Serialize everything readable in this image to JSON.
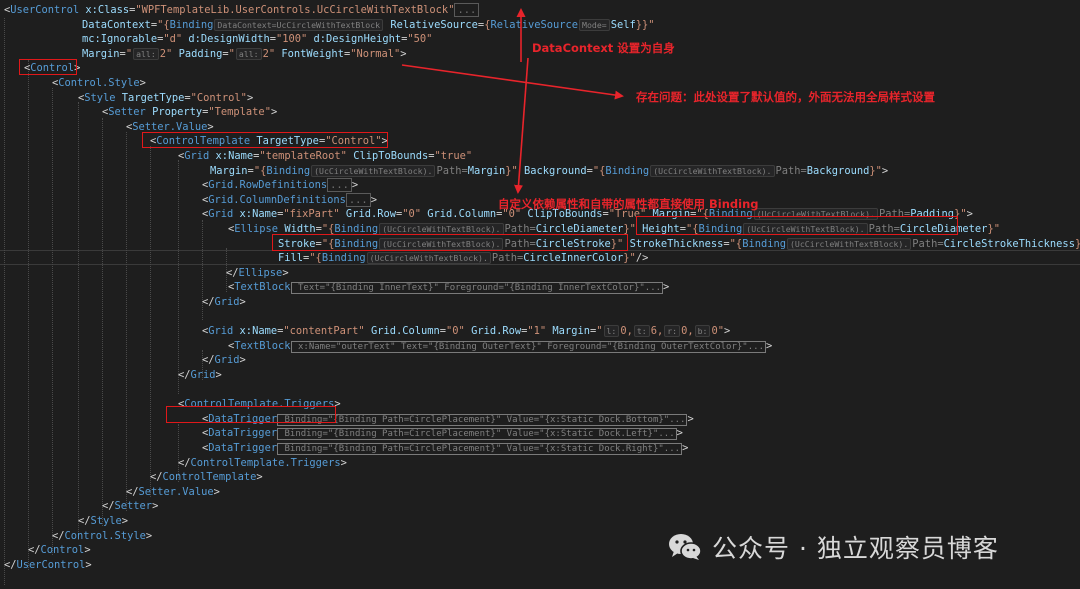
{
  "editor": {
    "lines": [
      [
        [
          "x",
          "<"
        ],
        [
          "t",
          "UserControl"
        ],
        [
          "a",
          " x:Class"
        ],
        [
          "x",
          "="
        ],
        [
          "s",
          "\"WPFTemplateLib.UserControls.UcCircleWithTextBlock\""
        ],
        [
          "f",
          "..."
        ]
      ],
      [
        [
          "a",
          "DataContext"
        ],
        [
          "x",
          "="
        ],
        [
          "s",
          "\"{"
        ],
        [
          "t",
          "Binding"
        ],
        [
          "h",
          "DataContext=UcCircleWithTextBlock"
        ],
        [
          "a",
          " RelativeSource"
        ],
        [
          "x",
          "="
        ],
        [
          "s",
          "{"
        ],
        [
          "t",
          "RelativeSource"
        ],
        [
          "h",
          "Mode="
        ],
        [
          "a",
          "Self"
        ],
        [
          "s",
          "}}\""
        ]
      ],
      [
        [
          "a",
          "mc:Ignorable"
        ],
        [
          "x",
          "="
        ],
        [
          "s",
          "\"d\""
        ],
        [
          "a",
          " d:DesignWidth"
        ],
        [
          "x",
          "="
        ],
        [
          "s",
          "\"100\""
        ],
        [
          "a",
          " d:DesignHeight"
        ],
        [
          "x",
          "="
        ],
        [
          "s",
          "\"50\""
        ]
      ],
      [
        [
          "a",
          "Margin"
        ],
        [
          "x",
          "="
        ],
        [
          "s",
          "\""
        ],
        [
          "h",
          "all:"
        ],
        [
          "s",
          "2\""
        ],
        [
          "a",
          " Padding"
        ],
        [
          "x",
          "="
        ],
        [
          "s",
          "\""
        ],
        [
          "h",
          "all:"
        ],
        [
          "s",
          "2\""
        ],
        [
          "a",
          " FontWeight"
        ],
        [
          "x",
          "="
        ],
        [
          "s",
          "\"Normal\""
        ],
        [
          "x",
          ">"
        ]
      ],
      [
        [
          "x",
          "<"
        ],
        [
          "t",
          "Control"
        ],
        [
          "x",
          ">"
        ]
      ],
      [
        [
          "x",
          "<"
        ],
        [
          "t",
          "Control.Style"
        ],
        [
          "x",
          ">"
        ]
      ],
      [
        [
          "x",
          "<"
        ],
        [
          "t",
          "Style"
        ],
        [
          "a",
          " TargetType"
        ],
        [
          "x",
          "="
        ],
        [
          "s",
          "\"Control\""
        ],
        [
          "x",
          ">"
        ]
      ],
      [
        [
          "x",
          "<"
        ],
        [
          "t",
          "Setter"
        ],
        [
          "a",
          " Property"
        ],
        [
          "x",
          "="
        ],
        [
          "s",
          "\"Template\""
        ],
        [
          "x",
          ">"
        ]
      ],
      [
        [
          "x",
          "<"
        ],
        [
          "t",
          "Setter.Value"
        ],
        [
          "x",
          ">"
        ]
      ],
      [
        [
          "x",
          "<"
        ],
        [
          "t",
          "ControlTemplate"
        ],
        [
          "a",
          " TargetType"
        ],
        [
          "x",
          "="
        ],
        [
          "s",
          "\"Control\""
        ],
        [
          "x",
          ">"
        ]
      ],
      [
        [
          "x",
          "<"
        ],
        [
          "t",
          "Grid"
        ],
        [
          "a",
          " x:Name"
        ],
        [
          "x",
          "="
        ],
        [
          "s",
          "\"templateRoot\""
        ],
        [
          "a",
          " ClipToBounds"
        ],
        [
          "x",
          "="
        ],
        [
          "s",
          "\"true\""
        ]
      ],
      [
        [
          "a",
          "Margin"
        ],
        [
          "x",
          "="
        ],
        [
          "s",
          "\"{"
        ],
        [
          "t",
          "Binding"
        ],
        [
          "h",
          "(UcCircleWithTextBlock)."
        ],
        [
          "d",
          "Path="
        ],
        [
          "a",
          "Margin"
        ],
        [
          "s",
          "}\""
        ],
        [
          "a",
          " Background"
        ],
        [
          "x",
          "="
        ],
        [
          "s",
          "\"{"
        ],
        [
          "t",
          "Binding"
        ],
        [
          "h",
          "(UcCircleWithTextBlock)."
        ],
        [
          "d",
          "Path="
        ],
        [
          "a",
          "Background"
        ],
        [
          "s",
          "}\""
        ],
        [
          "x",
          ">"
        ]
      ],
      [
        [
          "x",
          "<"
        ],
        [
          "t",
          "Grid.RowDefinitions"
        ],
        [
          "f",
          "..."
        ],
        [
          "x",
          ">"
        ]
      ],
      [
        [
          "x",
          "<"
        ],
        [
          "t",
          "Grid.ColumnDefinitions"
        ],
        [
          "f",
          "..."
        ],
        [
          "x",
          ">"
        ]
      ],
      [
        [
          "x",
          "<"
        ],
        [
          "t",
          "Grid"
        ],
        [
          "a",
          " x:Name"
        ],
        [
          "x",
          "="
        ],
        [
          "s",
          "\"fixPart\""
        ],
        [
          "a",
          " Grid.Row"
        ],
        [
          "x",
          "="
        ],
        [
          "s",
          "\"0\""
        ],
        [
          "a",
          " Grid.Column"
        ],
        [
          "x",
          "="
        ],
        [
          "s",
          "\"0\""
        ],
        [
          "a",
          " ClipToBounds"
        ],
        [
          "x",
          "="
        ],
        [
          "s",
          "\"True\""
        ],
        [
          "a",
          " Margin"
        ],
        [
          "x",
          "="
        ],
        [
          "s",
          "\"{"
        ],
        [
          "t",
          "Binding"
        ],
        [
          "h",
          "(UcCircleWithTextBlock)."
        ],
        [
          "d",
          "Path="
        ],
        [
          "a",
          "Padding"
        ],
        [
          "s",
          "}\""
        ],
        [
          "x",
          ">"
        ]
      ],
      [
        [
          "x",
          "<"
        ],
        [
          "t",
          "Ellipse"
        ],
        [
          "a",
          " Width"
        ],
        [
          "x",
          "="
        ],
        [
          "s",
          "\"{"
        ],
        [
          "t",
          "Binding"
        ],
        [
          "h",
          "(UcCircleWithTextBlock)."
        ],
        [
          "d",
          "Path="
        ],
        [
          "a",
          "CircleDiameter"
        ],
        [
          "s",
          "}\""
        ],
        [
          "a",
          " Height"
        ],
        [
          "x",
          "="
        ],
        [
          "s",
          "\"{"
        ],
        [
          "t",
          "Binding"
        ],
        [
          "h",
          "(UcCircleWithTextBlock)."
        ],
        [
          "d",
          "Path="
        ],
        [
          "a",
          "CircleDiameter"
        ],
        [
          "s",
          "}\""
        ]
      ],
      [
        [
          "a",
          "Stroke"
        ],
        [
          "x",
          "="
        ],
        [
          "s",
          "\"{"
        ],
        [
          "t",
          "Binding"
        ],
        [
          "h",
          "(UcCircleWithTextBlock)."
        ],
        [
          "d",
          "Path="
        ],
        [
          "a",
          "CircleStroke"
        ],
        [
          "s",
          "}\""
        ],
        [
          "a",
          " StrokeThickness"
        ],
        [
          "x",
          "="
        ],
        [
          "s",
          "\"{"
        ],
        [
          "t",
          "Binding"
        ],
        [
          "h",
          "(UcCircleWithTextBlock)."
        ],
        [
          "d",
          "Path="
        ],
        [
          "a",
          "CircleStrokeThickness"
        ],
        [
          "s",
          "}\""
        ]
      ],
      [
        [
          "a",
          "Fill"
        ],
        [
          "x",
          "="
        ],
        [
          "s",
          "\"{"
        ],
        [
          "t",
          "Binding"
        ],
        [
          "h",
          "(UcCircleWithTextBlock)."
        ],
        [
          "d",
          "Path="
        ],
        [
          "a",
          "CircleInnerColor"
        ],
        [
          "s",
          "}\""
        ],
        [
          "x",
          "/>"
        ]
      ],
      [
        [
          "x",
          "</"
        ],
        [
          "t",
          "Ellipse"
        ],
        [
          "x",
          ">"
        ]
      ],
      [
        [
          "x",
          "<"
        ],
        [
          "t",
          "TextBlock"
        ],
        [
          "e",
          " Text=\"{Binding InnerText}\" Foreground=\"{Binding InnerTextColor}\"..."
        ],
        [
          "x",
          ">"
        ]
      ],
      [
        [
          "x",
          "</"
        ],
        [
          "t",
          "Grid"
        ],
        [
          "x",
          ">"
        ]
      ],
      [],
      [
        [
          "x",
          "<"
        ],
        [
          "t",
          "Grid"
        ],
        [
          "a",
          " x:Name"
        ],
        [
          "x",
          "="
        ],
        [
          "s",
          "\"contentPart\""
        ],
        [
          "a",
          " Grid.Column"
        ],
        [
          "x",
          "="
        ],
        [
          "s",
          "\"0\""
        ],
        [
          "a",
          " Grid.Row"
        ],
        [
          "x",
          "="
        ],
        [
          "s",
          "\"1\""
        ],
        [
          "a",
          " Margin"
        ],
        [
          "x",
          "="
        ],
        [
          "s",
          "\""
        ],
        [
          "h",
          "l:"
        ],
        [
          "s",
          "0,"
        ],
        [
          "h",
          "t:"
        ],
        [
          "s",
          "6,"
        ],
        [
          "h",
          "r:"
        ],
        [
          "s",
          "0,"
        ],
        [
          "h",
          "b:"
        ],
        [
          "s",
          "0\""
        ],
        [
          "x",
          ">"
        ]
      ],
      [
        [
          "x",
          "<"
        ],
        [
          "t",
          "TextBlock"
        ],
        [
          "e",
          " x:Name=\"outerText\" Text=\"{Binding OuterText}\" Foreground=\"{Binding OuterTextColor}\"..."
        ],
        [
          "x",
          ">"
        ]
      ],
      [
        [
          "x",
          "</"
        ],
        [
          "t",
          "Grid"
        ],
        [
          "x",
          ">"
        ]
      ],
      [
        [
          "x",
          "</"
        ],
        [
          "t",
          "Grid"
        ],
        [
          "x",
          ">"
        ]
      ],
      [],
      [
        [
          "x",
          "<"
        ],
        [
          "t",
          "ControlTemplate.Triggers"
        ],
        [
          "x",
          ">"
        ]
      ],
      [
        [
          "x",
          "<"
        ],
        [
          "t",
          "DataTrigger"
        ],
        [
          "e",
          " Binding=\"{Binding Path=CirclePlacement}\" Value=\"{x:Static Dock.Bottom}\"..."
        ],
        [
          "x",
          ">"
        ]
      ],
      [
        [
          "x",
          "<"
        ],
        [
          "t",
          "DataTrigger"
        ],
        [
          "e",
          " Binding=\"{Binding Path=CirclePlacement}\" Value=\"{x:Static Dock.Left}\"..."
        ],
        [
          "x",
          ">"
        ]
      ],
      [
        [
          "x",
          "<"
        ],
        [
          "t",
          "DataTrigger"
        ],
        [
          "e",
          " Binding=\"{Binding Path=CirclePlacement}\" Value=\"{x:Static Dock.Right}\"..."
        ],
        [
          "x",
          ">"
        ]
      ],
      [
        [
          "x",
          "</"
        ],
        [
          "t",
          "ControlTemplate.Triggers"
        ],
        [
          "x",
          ">"
        ]
      ],
      [
        [
          "x",
          "</"
        ],
        [
          "t",
          "ControlTemplate"
        ],
        [
          "x",
          ">"
        ]
      ],
      [
        [
          "x",
          "</"
        ],
        [
          "t",
          "Setter.Value"
        ],
        [
          "x",
          ">"
        ]
      ],
      [
        [
          "x",
          "</"
        ],
        [
          "t",
          "Setter"
        ],
        [
          "x",
          ">"
        ]
      ],
      [
        [
          "x",
          "</"
        ],
        [
          "t",
          "Style"
        ],
        [
          "x",
          ">"
        ]
      ],
      [
        [
          "x",
          "</"
        ],
        [
          "t",
          "Control.Style"
        ],
        [
          "x",
          ">"
        ]
      ],
      [
        [
          "x",
          "</"
        ],
        [
          "t",
          "Control"
        ],
        [
          "x",
          ">"
        ]
      ],
      [
        [
          "x",
          "</"
        ],
        [
          "t",
          "UserControl"
        ],
        [
          "x",
          ">"
        ]
      ]
    ]
  },
  "annotations": {
    "datacontext_note": "DataContext 设置为自身",
    "problem_note": "存在问题：此处设置了默认值的，外面无法用全局样式设置",
    "binding_note": "自定义依赖属性和自带的属性都直接使用 Binding"
  },
  "colors": {
    "background": "#1e1e1e",
    "tag": "#569cd6",
    "attribute": "#9cdcfe",
    "string": "#ce9178",
    "annotation": "#e8242b"
  },
  "watermark": {
    "text": "公众号 · 独立观察员博客",
    "icon": "wechat-icon"
  }
}
